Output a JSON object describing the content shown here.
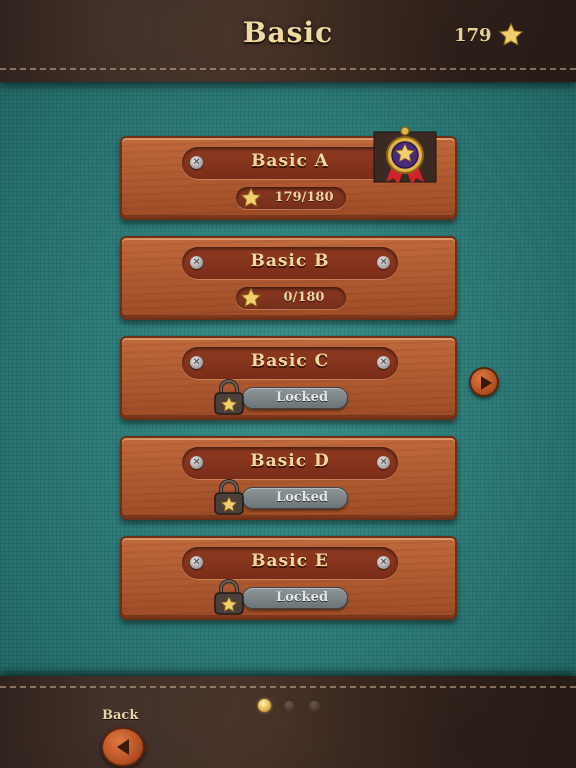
{
  "header": {
    "title": "Basic",
    "total_stars": "179"
  },
  "levels": [
    {
      "name": "Basic A",
      "status": "unlocked",
      "progress": "179/180",
      "has_medal": true
    },
    {
      "name": "Basic B",
      "status": "unlocked",
      "progress": "0/180"
    },
    {
      "name": "Basic C",
      "status": "locked",
      "locked_label": "Locked"
    },
    {
      "name": "Basic D",
      "status": "locked",
      "locked_label": "Locked"
    },
    {
      "name": "Basic E",
      "status": "locked",
      "locked_label": "Locked"
    }
  ],
  "footer": {
    "back_label": "Back",
    "page_count": 3,
    "current_page": 1
  },
  "icons": {
    "star": "star-icon",
    "lock": "lock-icon",
    "medal": "medal-icon",
    "next": "play-arrow-icon",
    "back": "back-arrow-icon"
  },
  "colors": {
    "background": "#2c8c88",
    "wood": "#b05a31",
    "gold_text": "#f0d6a0",
    "leather": "#3a2a22"
  }
}
